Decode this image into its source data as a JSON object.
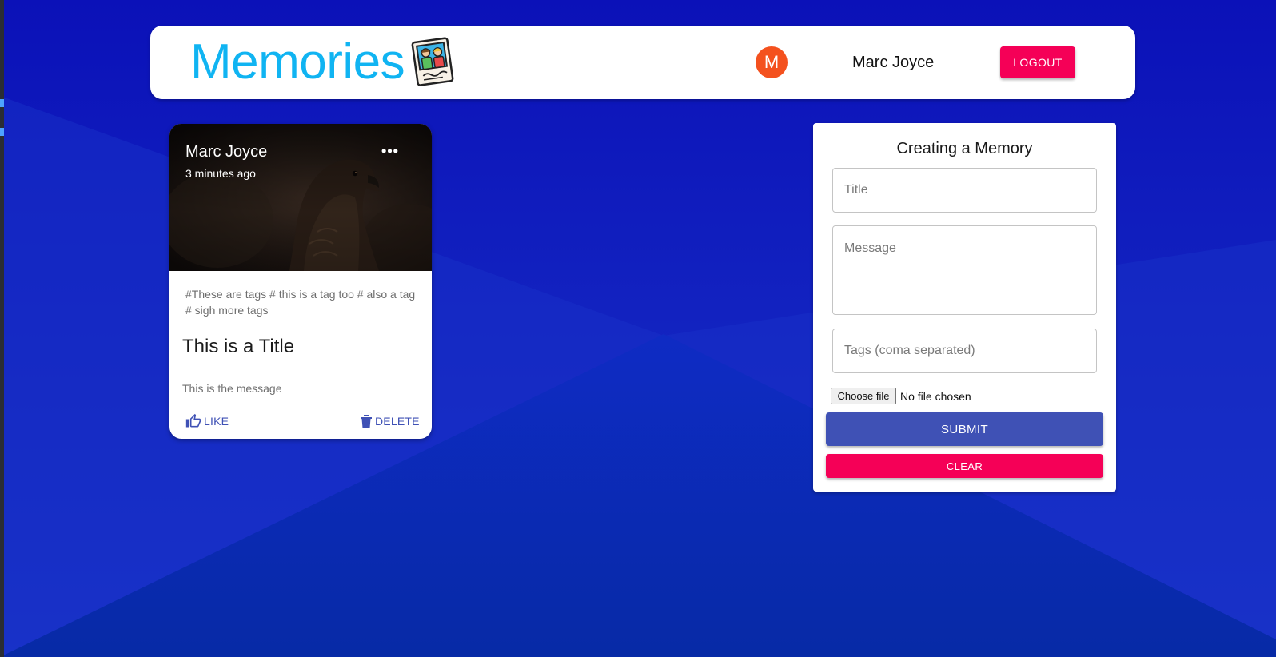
{
  "app": {
    "brand": "Memories",
    "logo_icon": "photo-of-people-icon"
  },
  "user": {
    "avatar_initial": "M",
    "name": "Marc Joyce",
    "avatar_color": "#f4511e"
  },
  "header": {
    "logout_label": "LOGOUT"
  },
  "post": {
    "author": "Marc Joyce",
    "time": "3 minutes ago",
    "more_label": "•••",
    "image": "eagle-photo",
    "tags": "#These are tags # this is a tag too # also a tag # sigh more tags",
    "title": "This is a Title",
    "message": "This is the message",
    "like_label": "LIKE",
    "delete_label": "DELETE"
  },
  "form": {
    "heading": "Creating a Memory",
    "title_placeholder": "Title",
    "message_placeholder": "Message",
    "tags_placeholder": "Tags (coma separated)",
    "choose_file_label": "Choose file",
    "file_status": "No file chosen",
    "submit_label": "SUBMIT",
    "clear_label": "CLEAR"
  },
  "colors": {
    "brand": "#10b4f2",
    "primary": "#3f51b5",
    "secondary": "#f50057",
    "background": "#0a17b8"
  }
}
